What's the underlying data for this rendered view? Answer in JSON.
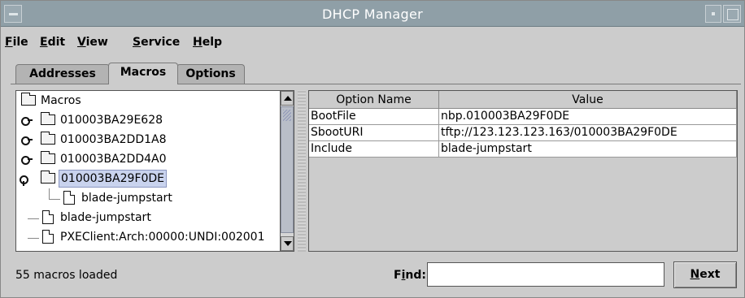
{
  "window": {
    "title": "DHCP Manager"
  },
  "menu": [
    {
      "mn": "F",
      "rest": "ile"
    },
    {
      "mn": "E",
      "rest": "dit"
    },
    {
      "mn": "V",
      "rest": "iew"
    },
    {
      "mn": "S",
      "rest": "ervice"
    },
    {
      "mn": "H",
      "rest": "elp"
    }
  ],
  "tabs": [
    "Addresses",
    "Macros",
    "Options"
  ],
  "active_tab": "Macros",
  "tree": {
    "root": "Macros",
    "items": [
      "010003BA29E628",
      "010003BA2DD1A8",
      "010003BA2DD4A0",
      "010003BA29F0DE",
      "blade-jumpstart",
      "blade-jumpstart",
      "PXEClient:Arch:00000:UNDI:002001"
    ],
    "selected": "010003BA29F0DE"
  },
  "table": {
    "headers": [
      "Option Name",
      "Value"
    ],
    "rows": [
      [
        "BootFile",
        "nbp.010003BA29F0DE"
      ],
      [
        "SbootURI",
        "tftp://123.123.123.163/010003BA29F0DE"
      ],
      [
        "Include",
        "blade-jumpstart"
      ]
    ]
  },
  "status": {
    "text": "55 macros loaded"
  },
  "find": {
    "label_mn": "i",
    "label_pre": "F",
    "label_post": "nd:",
    "value": ""
  },
  "next_button": {
    "mn": "N",
    "rest": "ext"
  }
}
